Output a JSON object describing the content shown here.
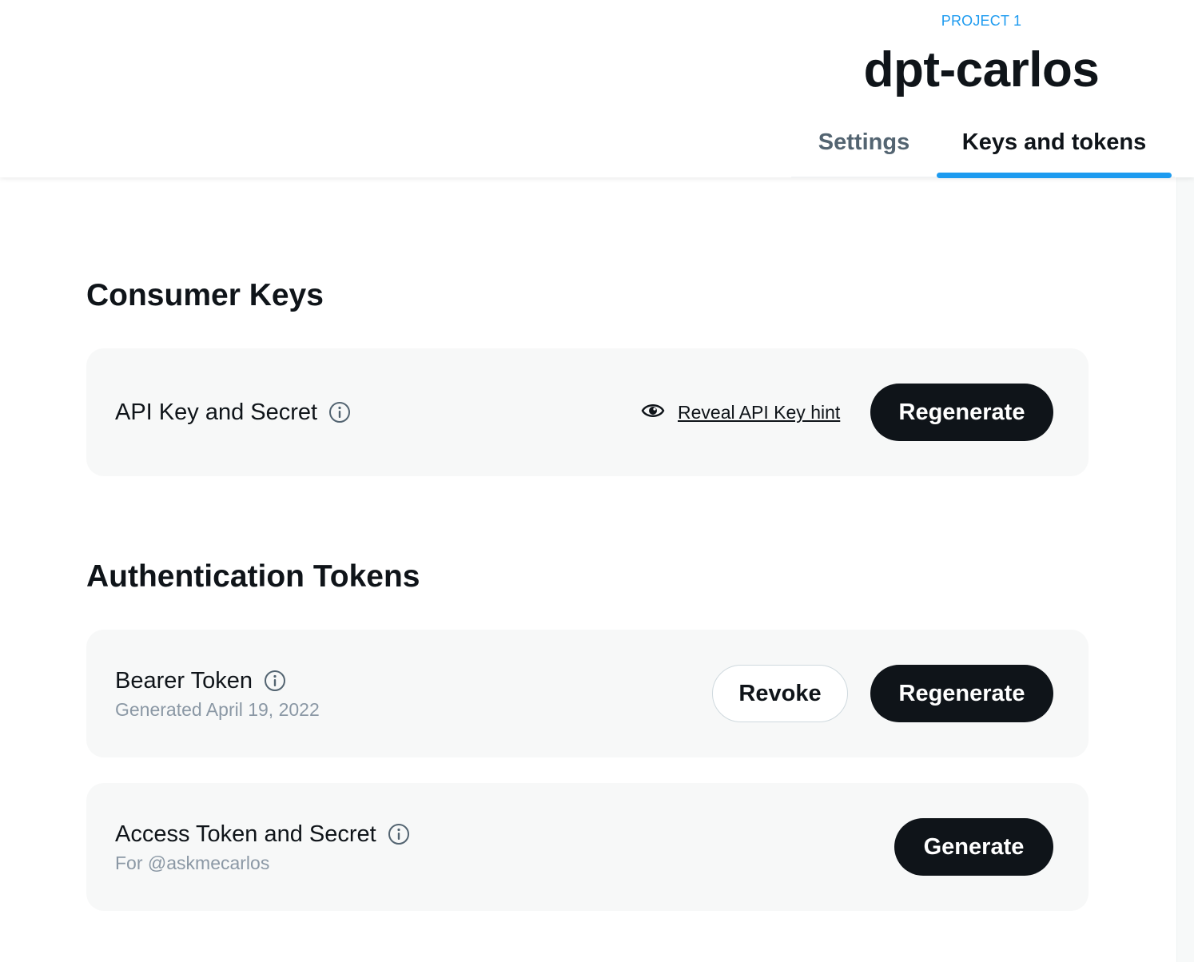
{
  "header": {
    "project_label": "PROJECT 1",
    "app_name": "dpt-carlos",
    "tabs": [
      {
        "label": "Settings",
        "active": false
      },
      {
        "label": "Keys and tokens",
        "active": true
      }
    ]
  },
  "consumer_keys": {
    "title": "Consumer Keys",
    "api_key": {
      "label": "API Key and Secret",
      "reveal_link": "Reveal API Key hint",
      "regenerate_label": "Regenerate"
    }
  },
  "auth_tokens": {
    "title": "Authentication Tokens",
    "bearer": {
      "label": "Bearer Token",
      "subtitle": "Generated April 19, 2022",
      "revoke_label": "Revoke",
      "regenerate_label": "Regenerate"
    },
    "access": {
      "label": "Access Token and Secret",
      "subtitle": "For @askmecarlos",
      "generate_label": "Generate"
    }
  },
  "icons": {
    "info": "info-icon",
    "eye": "eye-icon"
  },
  "colors": {
    "accent": "#1d9bf0",
    "text": "#0f1419",
    "muted": "#536471",
    "subtle": "#8b98a5",
    "card": "#f7f8f8",
    "button_dark": "#0f1419"
  }
}
